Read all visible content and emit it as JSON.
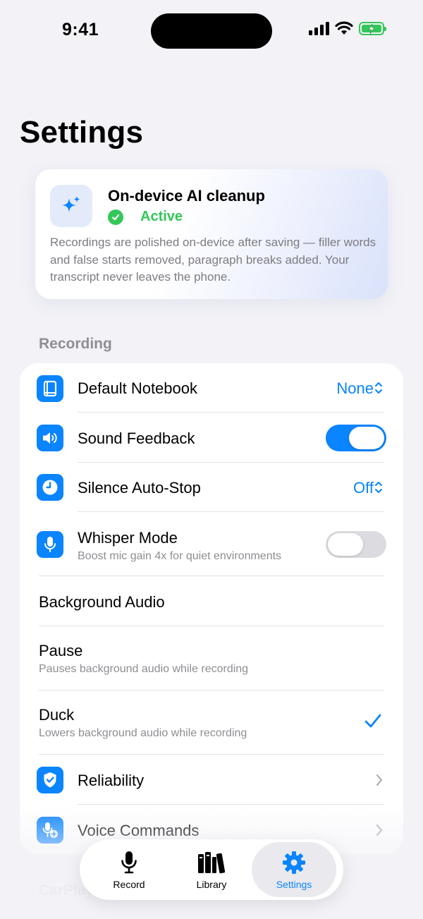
{
  "status_bar": {
    "time": "9:41"
  },
  "header": {
    "title": "Settings"
  },
  "ai_card": {
    "title": "On-device AI cleanup",
    "status": "Active",
    "description": "Recordings are polished on-device after saving — filler words and false starts removed, paragraph breaks added. Your transcript never leaves the phone.",
    "status_color": "#34c759",
    "icon": "sparkles-icon"
  },
  "recording": {
    "header": "Recording",
    "default_notebook": {
      "label": "Default Notebook",
      "value": "None",
      "icon": "book-icon"
    },
    "sound_feedback": {
      "label": "Sound Feedback",
      "enabled": true,
      "icon": "speaker-icon"
    },
    "silence_auto_stop": {
      "label": "Silence Auto-Stop",
      "value": "Off",
      "icon": "clock-icon"
    },
    "whisper_mode": {
      "label": "Whisper Mode",
      "subtitle": "Boost mic gain 4x for quiet environments",
      "enabled": false,
      "icon": "mic-icon"
    },
    "background_audio": {
      "label": "Background Audio",
      "options": [
        {
          "label": "Pause",
          "subtitle": "Pauses background audio while recording",
          "selected": false
        },
        {
          "label": "Duck",
          "subtitle": "Lowers background audio while recording",
          "selected": true
        }
      ]
    },
    "reliability": {
      "label": "Reliability",
      "icon": "shield-check-icon"
    },
    "voice_commands": {
      "label": "Voice Commands",
      "icon": "mic-plus-icon"
    }
  },
  "carplay": {
    "header": "CarPlay"
  },
  "tabbar": {
    "tabs": [
      {
        "label": "Record",
        "icon": "mic-icon",
        "active": false
      },
      {
        "label": "Library",
        "icon": "books-icon",
        "active": false
      },
      {
        "label": "Settings",
        "icon": "gear-icon",
        "active": true
      }
    ]
  },
  "colors": {
    "accent": "#0a84ff",
    "success": "#34c759",
    "background": "#f2f2f7"
  }
}
